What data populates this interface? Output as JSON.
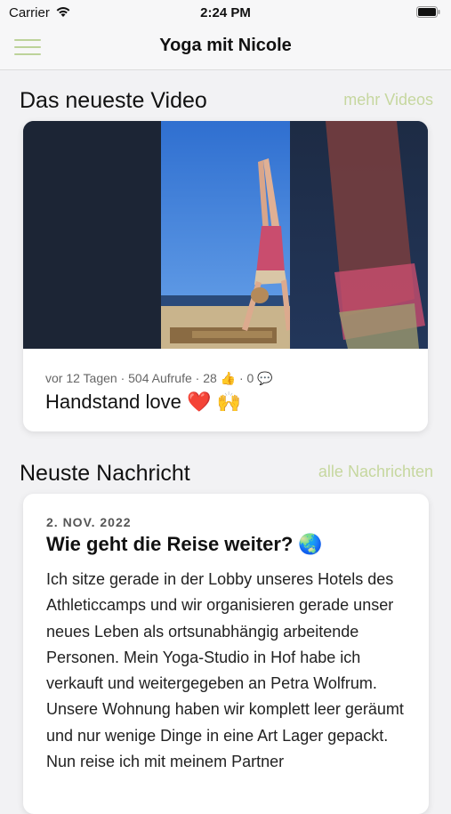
{
  "status_bar": {
    "carrier": "Carrier",
    "time": "2:24 PM"
  },
  "nav": {
    "title": "Yoga mit Nicole",
    "menu_icon": "hamburger-icon"
  },
  "latest_video": {
    "section_title": "Das neueste Video",
    "link": "mehr Videos",
    "meta": "vor 12 Tagen · 504 Aufrufe · 28 👍 · 0 💬",
    "title": "Handstand love ❤️ 🙌"
  },
  "latest_news": {
    "section_title": "Neuste Nachricht",
    "link": "alle Nachrichten",
    "date": "2. NOV. 2022",
    "title": "Wie geht die Reise weiter? 🌏",
    "body": "Ich sitze gerade in der Lobby unseres Hotels des Athleticcamps und wir organisieren gerade unser neues Leben als ortsunabhängig arbeitende Personen. Mein Yoga-Studio in Hof habe ich verkauft und weitergegeben an Petra Wolfrum. Unsere Wohnung haben wir komplett leer geräumt und nur wenige Dinge in eine Art Lager gepackt. Nun reise ich mit meinem Partner"
  },
  "colors": {
    "accent": "#c6d79f",
    "background": "#f2f2f4"
  }
}
